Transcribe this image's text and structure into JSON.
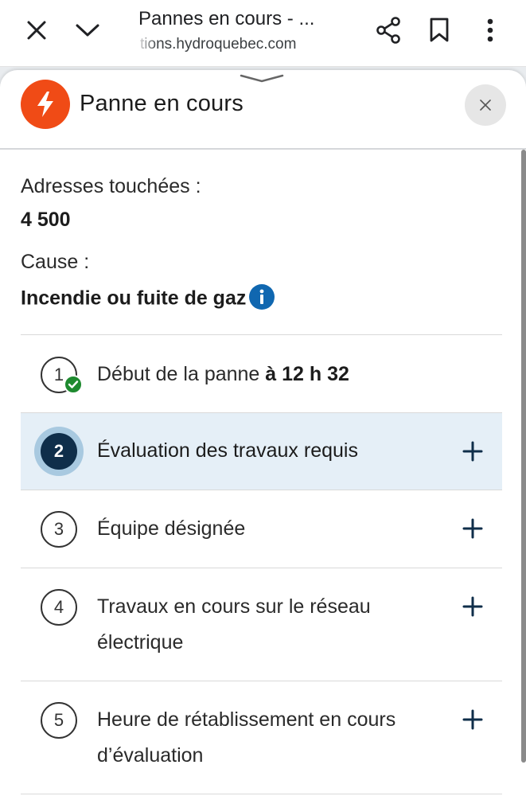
{
  "browser": {
    "title": "Pannes en cours - ...",
    "url": "tions.hydroquebec.com",
    "icons": [
      "close-icon",
      "chevron-down-icon",
      "share-icon",
      "bookmark-icon",
      "more-vert-icon"
    ]
  },
  "panel": {
    "title": "Panne en cours",
    "accent_color": "#f04b16",
    "addresses_label": "Adresses touchées :",
    "addresses_value": "4 500",
    "cause_label": "Cause :",
    "cause_value": "Incendie ou fuite de gaz",
    "steps": [
      {
        "number": "1",
        "text": "Début de la panne",
        "bold_suffix": "à 12 h 32",
        "status": "completed"
      },
      {
        "number": "2",
        "text": "Évaluation des travaux requis",
        "status": "current"
      },
      {
        "number": "3",
        "text": "Équipe désignée",
        "status": "pending"
      },
      {
        "number": "4",
        "text": "Travaux en cours sur le réseau électrique",
        "status": "pending"
      },
      {
        "number": "5",
        "text": "Heure de rétablissement en cours d’évaluation",
        "status": "pending"
      }
    ]
  }
}
